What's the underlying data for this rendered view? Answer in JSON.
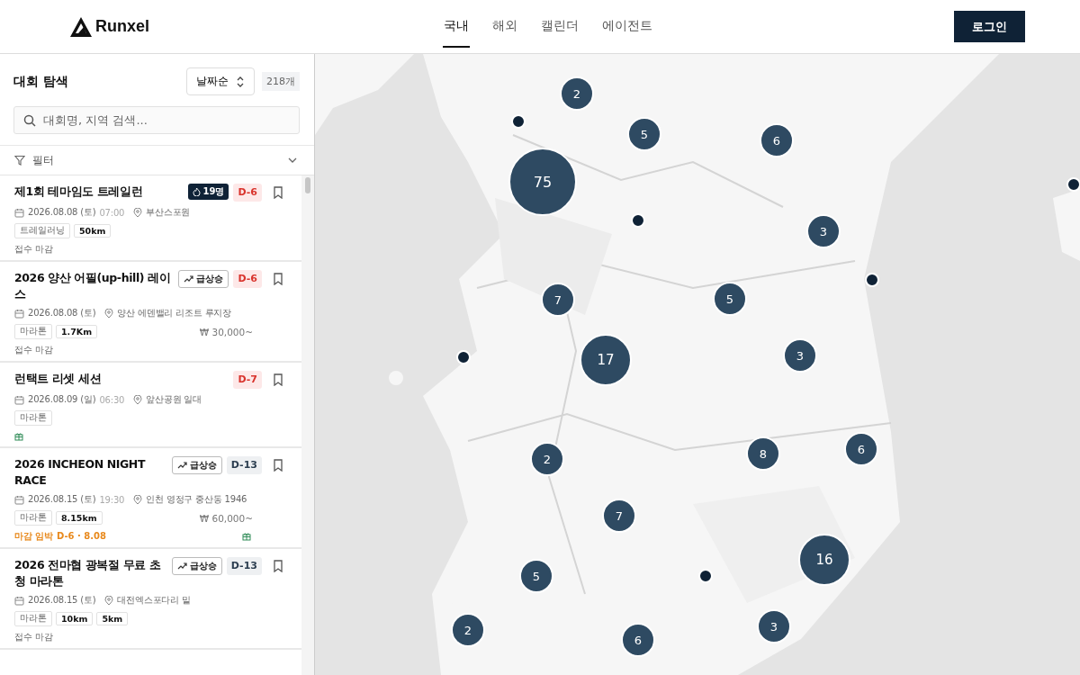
{
  "header": {
    "logo": "Runxel",
    "nav": [
      {
        "label": "국내",
        "selected": true
      },
      {
        "label": "해외",
        "selected": false
      },
      {
        "label": "캘린더",
        "selected": false
      },
      {
        "label": "에이전트",
        "selected": false
      }
    ],
    "login": "로그인"
  },
  "sidebar": {
    "title": "대회 탐색",
    "sort": "날짜순",
    "count": "218개",
    "search": {
      "placeholder": "대회명, 지역 검색..."
    },
    "filter": {
      "label": "필터",
      "expanded": false
    },
    "events": [
      {
        "title": "제1회 테마임도 트레일런",
        "badge": {
          "kind": "hot",
          "text": "19명"
        },
        "dday": "D-6",
        "urgent": true,
        "date": "2026.08.08 (토)",
        "time": "07:00",
        "place": "부산스포원",
        "tags": [
          {
            "text": "트레일러닝",
            "kind": "category"
          },
          {
            "text": "50km",
            "kind": "distance"
          }
        ],
        "status": {
          "text": "접수 마감",
          "kind": "closed"
        },
        "gift": false,
        "bookmarked": false
      },
      {
        "title": "2026 양산 어필(up-hill) 레이스",
        "badge": {
          "kind": "trending",
          "text": "급상승"
        },
        "dday": "D-6",
        "urgent": true,
        "date": "2026.08.08 (토)",
        "place": "양산 에덴밸리 리조트 루지장",
        "tags": [
          {
            "text": "마라톤",
            "kind": "category"
          },
          {
            "text": "1.7Km",
            "kind": "distance"
          }
        ],
        "price": "₩ 30,000~",
        "status": {
          "text": "접수 마감",
          "kind": "closed"
        },
        "gift": false,
        "bookmarked": false
      },
      {
        "title": "런택트 리셋 세션",
        "dday": "D-7",
        "urgent": true,
        "date": "2026.08.09 (일)",
        "time": "06:30",
        "place": "앞산공원 일대",
        "tags": [
          {
            "text": "마라톤",
            "kind": "category"
          }
        ],
        "gift": true,
        "bookmarked": false
      },
      {
        "title": "2026 INCHEON NIGHT RACE",
        "badge": {
          "kind": "trending",
          "text": "급상승"
        },
        "dday": "D-13",
        "urgent": false,
        "date": "2026.08.15 (토)",
        "time": "19:30",
        "place": "인천 영정구 중산동 1946",
        "tags": [
          {
            "text": "마라톤",
            "kind": "category"
          },
          {
            "text": "8.15km",
            "kind": "distance"
          }
        ],
        "price": "₩ 60,000~",
        "status": {
          "text": "마감 임박 D-6 · 8.08",
          "kind": "closing"
        },
        "gift": true,
        "bookmarked": false
      },
      {
        "title": "2026 전마협 광복절 무료 초청 마라톤",
        "badge": {
          "kind": "trending",
          "text": "급상승"
        },
        "dday": "D-13",
        "urgent": false,
        "date": "2026.08.15 (토)",
        "place": "대전엑스포다리 밑",
        "tags": [
          {
            "text": "마라톤",
            "kind": "category"
          },
          {
            "text": "10km",
            "kind": "distance"
          },
          {
            "text": "5km",
            "kind": "distance"
          }
        ],
        "status": {
          "text": "접수 마감",
          "kind": "closed"
        },
        "gift": false,
        "bookmarked": false
      }
    ]
  },
  "map": {
    "clusters": [
      {
        "count": "2"
      },
      {
        "count": "5"
      },
      {
        "count": "6"
      },
      {
        "count": "75"
      },
      {
        "count": "3"
      },
      {
        "count": "7"
      },
      {
        "count": "5"
      },
      {
        "count": "17"
      },
      {
        "count": "3"
      },
      {
        "count": "2"
      },
      {
        "count": "8"
      },
      {
        "count": "6"
      },
      {
        "count": "7"
      },
      {
        "count": "16"
      },
      {
        "count": "5"
      },
      {
        "count": "2"
      },
      {
        "count": "6"
      },
      {
        "count": "3"
      }
    ]
  }
}
